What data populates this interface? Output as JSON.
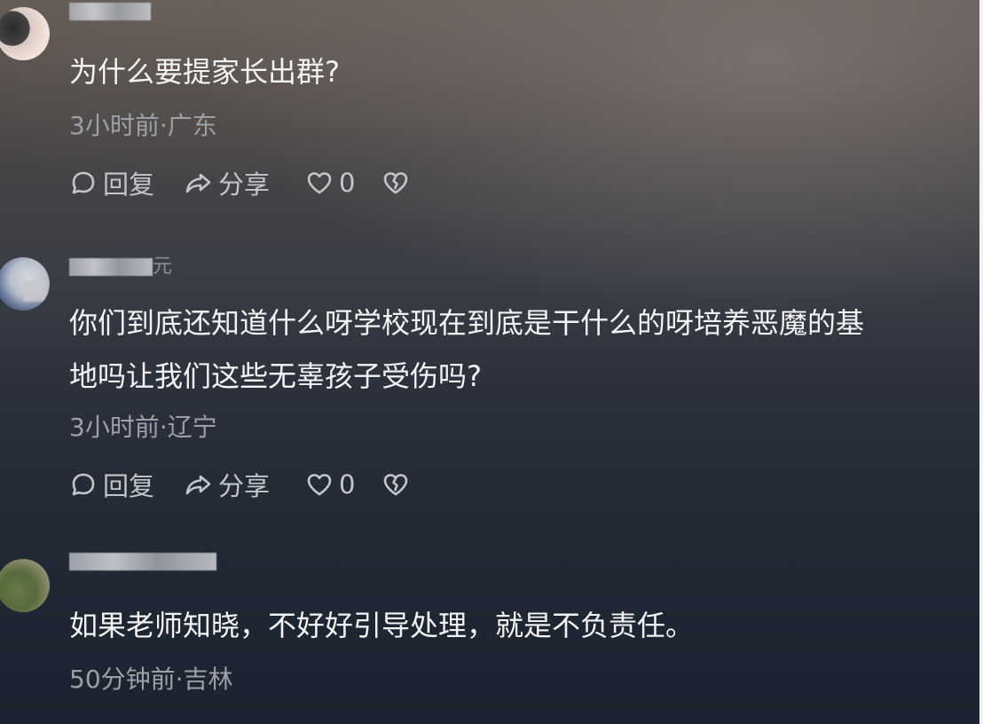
{
  "comments": [
    {
      "username_visible": "",
      "text_lines": [
        "为什么要提家长出群?"
      ],
      "time": "3小时前",
      "location": "广东",
      "actions": {
        "reply": "回复",
        "share": "分享",
        "likes": "0"
      }
    },
    {
      "username_visible": "元",
      "text_lines": [
        "你们到底还知道什么呀学校现在到底是干什么的呀培养恶魔的基",
        "地吗让我们这些无辜孩子受伤吗?"
      ],
      "time": "3小时前",
      "location": "辽宁",
      "actions": {
        "reply": "回复",
        "share": "分享",
        "likes": "0"
      }
    },
    {
      "username_visible": "",
      "text_lines": [
        "如果老师知晓，不好好引导处理，就是不负责任。"
      ],
      "time": "50分钟前",
      "location": "吉林"
    }
  ],
  "icons": [
    "reply-icon",
    "share-icon",
    "like-icon",
    "dislike-icon"
  ]
}
